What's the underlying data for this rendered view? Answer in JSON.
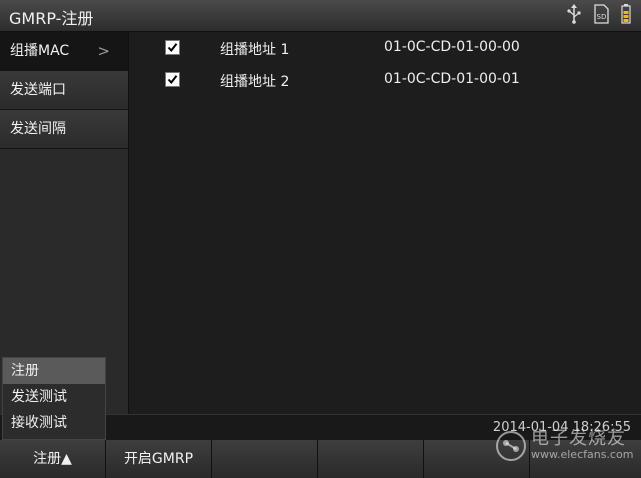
{
  "window": {
    "title": "GMRP-注册"
  },
  "status_icons": [
    {
      "name": "usb-icon"
    },
    {
      "name": "sd-card-icon",
      "label": "SD"
    },
    {
      "name": "battery-icon"
    }
  ],
  "sidebar": {
    "items": [
      {
        "label": "组播MAC",
        "active": true,
        "has_chevron": true
      },
      {
        "label": "发送端口"
      },
      {
        "label": "发送间隔"
      }
    ],
    "chevron": ">"
  },
  "entries": [
    {
      "checked": true,
      "name": "组播地址 1",
      "mac": "01-0C-CD-01-00-00"
    },
    {
      "checked": true,
      "name": "组播地址 2",
      "mac": "01-0C-CD-01-00-01"
    }
  ],
  "popup_menu": {
    "items": [
      {
        "label": "注册",
        "selected": true
      },
      {
        "label": "发送测试"
      },
      {
        "label": "接收测试"
      }
    ]
  },
  "statusbar": {
    "datetime": "2014-01-04 18:26:55"
  },
  "function_keys": [
    {
      "label": "注册▲"
    },
    {
      "label": "开启GMRP"
    },
    {
      "label": ""
    },
    {
      "label": ""
    },
    {
      "label": ""
    },
    {
      "label": ""
    }
  ],
  "watermark": {
    "text": "电子发烧友",
    "url": "www.elecfans.com"
  }
}
